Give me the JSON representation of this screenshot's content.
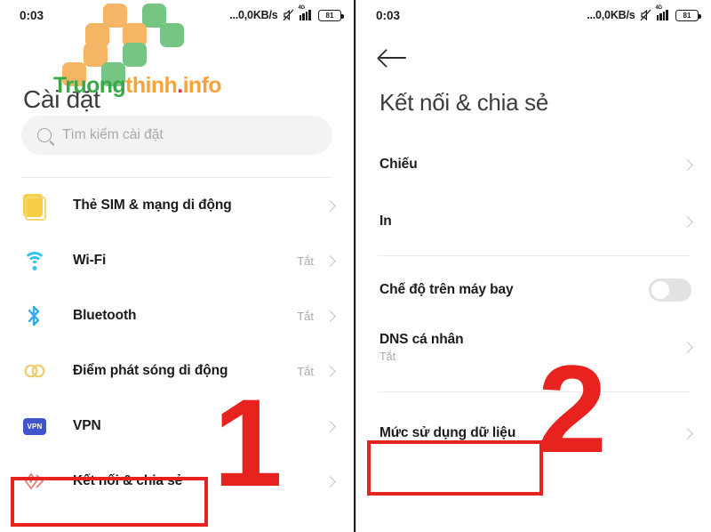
{
  "statusbar": {
    "time": "0:03",
    "speed": "...0,0KB/s",
    "network_label": "4G",
    "battery_level": "81",
    "mute_icon": "mute-icon",
    "signal_icon": "signal-bars-icon",
    "battery_icon": "battery-icon"
  },
  "watermark": {
    "text_part1": "Truong",
    "text_part2": "thinh",
    "text_dot": ".",
    "text_part3": "info",
    "color_green": "#3aa847",
    "color_orange": "#f6a33c",
    "color_red": "#e8342c"
  },
  "annotations": {
    "step_one": "1",
    "step_two": "2",
    "highlight_color": "#e8231f"
  },
  "left_screen": {
    "title": "Cài đặt",
    "search": {
      "placeholder": "Tìm kiếm cài đặt",
      "value": "",
      "icon": "search-icon"
    },
    "items": [
      {
        "label": "Thẻ SIM & mạng di động",
        "value": "",
        "icon": "sim-card-icon"
      },
      {
        "label": "Wi-Fi",
        "value": "Tắt",
        "icon": "wifi-icon"
      },
      {
        "label": "Bluetooth",
        "value": "Tắt",
        "icon": "bluetooth-icon"
      },
      {
        "label": "Điểm phát sóng di động",
        "value": "Tắt",
        "icon": "hotspot-icon"
      },
      {
        "label": "VPN",
        "value": "",
        "icon": "vpn-icon",
        "badge_text": "VPN"
      },
      {
        "label": "Kết nối & chia sẻ",
        "value": "",
        "icon": "connection-share-icon"
      }
    ]
  },
  "right_screen": {
    "back_icon": "back-arrow-icon",
    "title": "Kết nối & chia sẻ",
    "group_one": [
      {
        "label": "Chiếu",
        "subtitle": ""
      },
      {
        "label": "In",
        "subtitle": ""
      }
    ],
    "airplane": {
      "label": "Chế độ trên máy bay",
      "toggle_state": "off"
    },
    "dns": {
      "label": "DNS cá nhân",
      "subtitle": "Tắt"
    },
    "data_usage": {
      "label": "Mức sử dụng dữ liệu"
    }
  }
}
